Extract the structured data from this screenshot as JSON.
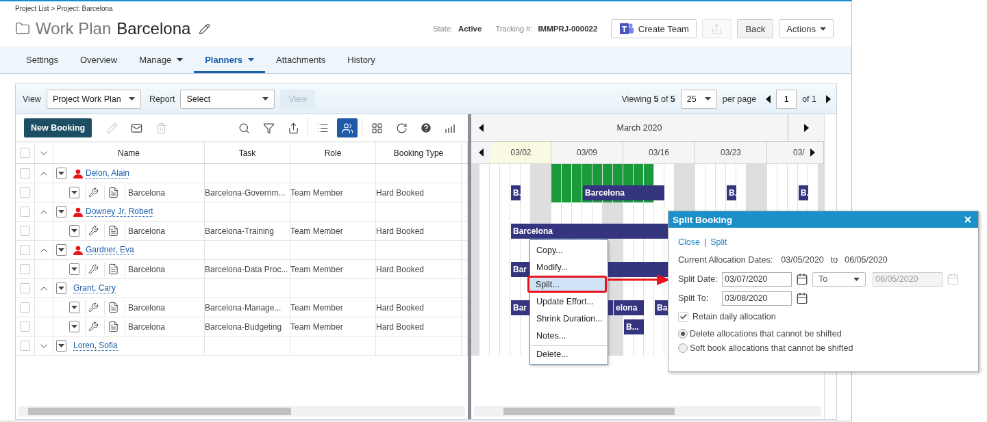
{
  "breadcrumb": "Project List > Project: Barcelona",
  "title": {
    "prefix": "Work Plan",
    "name": "Barcelona"
  },
  "meta": [
    {
      "label": "State:",
      "value": "Active"
    },
    {
      "label": "Tracking #:",
      "value": "IMMPRJ-000022"
    }
  ],
  "header_buttons": [
    {
      "kind": "team",
      "label": "Create Team",
      "disabled": false
    },
    {
      "kind": "export",
      "disabled": true
    },
    {
      "kind": "plain",
      "label": "Back",
      "disabled": false
    },
    {
      "kind": "dropdown",
      "label": "Actions",
      "disabled": false
    }
  ],
  "tabs": [
    {
      "label": "Settings",
      "selected": false,
      "dropdown": false
    },
    {
      "label": "Overview",
      "selected": false,
      "dropdown": false
    },
    {
      "label": "Manage",
      "selected": false,
      "dropdown": true
    },
    {
      "label": "Planners",
      "selected": true,
      "dropdown": true
    },
    {
      "label": "Attachments",
      "selected": false,
      "dropdown": false
    },
    {
      "label": "History",
      "selected": false,
      "dropdown": false
    }
  ],
  "filter_bar": {
    "view_label": "View",
    "view_value": "Project Work Plan",
    "report_label": "Report",
    "report_value": "Select",
    "view_button": {
      "label": "View",
      "disabled": true
    },
    "viewing": "Viewing **5** of **5**",
    "page_size": "25",
    "per_page": "per page",
    "page": "1",
    "of_pages": "of 1"
  },
  "toolbar": {
    "new_button": "New Booking",
    "groups": [
      [
        {
          "kind": "edit",
          "disabled": true,
          "selected": false
        },
        {
          "kind": "mail",
          "disabled": false,
          "selected": false
        },
        {
          "kind": "delete",
          "disabled": true,
          "selected": false
        }
      ],
      [
        {
          "kind": "search",
          "disabled": false,
          "selected": false
        },
        {
          "kind": "filter",
          "disabled": false,
          "selected": false
        },
        {
          "kind": "export",
          "disabled": false,
          "selected": false
        }
      ],
      [
        {
          "kind": "list",
          "disabled": false,
          "selected": false
        },
        {
          "kind": "people",
          "disabled": false,
          "selected": true
        }
      ],
      [
        {
          "kind": "grid",
          "disabled": false,
          "selected": false
        },
        {
          "kind": "refresh",
          "disabled": false,
          "selected": false
        },
        {
          "kind": "help",
          "disabled": false,
          "selected": false
        },
        {
          "kind": "chart",
          "disabled": false,
          "selected": false
        }
      ]
    ]
  },
  "grid": {
    "columns": [
      "Name",
      "Task",
      "Role",
      "Booking Type"
    ],
    "header_checked": false,
    "rows": [
      {
        "kind": "person",
        "name": "Delon, Alain",
        "alert": true,
        "expanded": true,
        "checked": false,
        "timeline": [
          {
            "kind": "gap"
          },
          {
            "kind": "gap"
          },
          {
            "kind": "gap"
          },
          {
            "kind": "gap"
          },
          {
            "kind": "gap"
          },
          {
            "kind": "gap"
          },
          {
            "kind": "gap"
          },
          {
            "kind": "alloc"
          },
          {
            "kind": "alloc"
          },
          {
            "kind": "alloc"
          },
          {
            "kind": "alloc"
          },
          {
            "kind": "alloc"
          },
          {
            "kind": "alloc"
          },
          {
            "kind": "alloc"
          },
          {
            "kind": "alloc"
          },
          {
            "kind": "alloc"
          },
          {
            "kind": "alloc"
          }
        ]
      },
      {
        "kind": "booking",
        "project": "Barcelona",
        "task": "Barcelona-Governm...",
        "role": "Team Member",
        "booking_type": "Hard Booked",
        "checked": false,
        "timeline": [
          {
            "kind": "gap"
          },
          {
            "kind": "gap"
          },
          {
            "kind": "gap"
          },
          {
            "kind": "bar",
            "label": "B."
          },
          {
            "kind": "gap"
          },
          {
            "kind": "gap"
          },
          {
            "kind": "gap"
          },
          {
            "kind": "alloc"
          },
          {
            "kind": "alloc"
          },
          {
            "kind": "alloc"
          },
          {
            "kind": "alloc-bar",
            "label": "Barcelona"
          },
          {
            "kind": "alloc-bar"
          },
          {
            "kind": "alloc-bar"
          },
          {
            "kind": "alloc-bar"
          },
          {
            "kind": "alloc-bar"
          },
          {
            "kind": "alloc-bar"
          },
          {
            "kind": "alloc-bar"
          },
          {
            "kind": "bar"
          },
          {
            "kind": "gap"
          },
          {
            "kind": "gap"
          },
          {
            "kind": "gap"
          },
          {
            "kind": "gap"
          },
          {
            "kind": "gap"
          },
          {
            "kind": "gap"
          },
          {
            "kind": "bar",
            "label": "B."
          },
          {
            "kind": "gap"
          },
          {
            "kind": "gap"
          },
          {
            "kind": "gap"
          },
          {
            "kind": "gap"
          },
          {
            "kind": "gap"
          },
          {
            "kind": "gap"
          },
          {
            "kind": "bar",
            "label": "B."
          }
        ]
      },
      {
        "kind": "person",
        "name": "Downey Jr, Robert",
        "alert": true,
        "expanded": true,
        "checked": false
      },
      {
        "kind": "booking",
        "project": "Barcelona",
        "task": "Barcelona-Training",
        "role": "Team Member",
        "booking_type": "Hard Booked",
        "checked": false,
        "timeline": [
          {
            "kind": "gap"
          },
          {
            "kind": "gap"
          },
          {
            "kind": "gap"
          },
          {
            "kind": "bar",
            "label": "Barcelona"
          },
          {
            "kind": "bar"
          },
          {
            "kind": "bar"
          },
          {
            "kind": "bar"
          },
          {
            "kind": "bar"
          },
          {
            "kind": "bar"
          },
          {
            "kind": "bar"
          },
          {
            "kind": "bar"
          },
          {
            "kind": "bar"
          },
          {
            "kind": "bar"
          },
          {
            "kind": "bar"
          },
          {
            "kind": "bar"
          },
          {
            "kind": "bar"
          },
          {
            "kind": "bar"
          },
          {
            "kind": "bar"
          },
          {
            "kind": "bar"
          },
          {
            "kind": "bar"
          },
          {
            "kind": "bar"
          }
        ]
      },
      {
        "kind": "person",
        "name": "Gardner, Eva",
        "alert": true,
        "expanded": true,
        "checked": false
      },
      {
        "kind": "booking",
        "project": "Barcelona",
        "task": "Barcelona-Data Proc...",
        "role": "Team Member",
        "booking_type": "Hard Booked",
        "checked": false,
        "timeline": [
          {
            "kind": "gap"
          },
          {
            "kind": "gap"
          },
          {
            "kind": "gap"
          },
          {
            "kind": "bar",
            "label": "Bar"
          },
          {
            "kind": "bar"
          },
          {
            "kind": "bar"
          },
          {
            "kind": "bar"
          },
          {
            "kind": "bar"
          },
          {
            "kind": "bar"
          },
          {
            "kind": "bar"
          },
          {
            "kind": "bar"
          },
          {
            "kind": "bar"
          },
          {
            "kind": "bar"
          },
          {
            "kind": "bar"
          },
          {
            "kind": "bar"
          },
          {
            "kind": "bar"
          },
          {
            "kind": "bar"
          },
          {
            "kind": "bar"
          },
          {
            "kind": "bar"
          },
          {
            "kind": "bar"
          },
          {
            "kind": "bar"
          }
        ]
      },
      {
        "kind": "person",
        "name": "Grant, Cary",
        "alert": false,
        "expanded": true,
        "checked": false
      },
      {
        "kind": "booking",
        "project": "Barcelona",
        "task": "Barcelona-Manage...",
        "role": "Team Member",
        "booking_type": "Hard Booked",
        "checked": false,
        "timeline": [
          {
            "kind": "gap"
          },
          {
            "kind": "gap"
          },
          {
            "kind": "gap"
          },
          {
            "kind": "bar",
            "label": "Bar"
          },
          {
            "kind": "bar"
          },
          {
            "kind": "bar"
          },
          {
            "kind": "bar"
          },
          {
            "kind": "bar"
          },
          {
            "kind": "bar"
          },
          {
            "kind": "bar"
          },
          {
            "kind": "bar"
          },
          {
            "kind": "bar"
          },
          {
            "kind": "bar"
          },
          {
            "kind": "bar",
            "label": "elona"
          },
          {
            "kind": "bar"
          },
          {
            "kind": "bar"
          },
          {
            "kind": "gap"
          },
          {
            "kind": "bar",
            "label": "Ba"
          },
          {
            "kind": "bar"
          },
          {
            "kind": "bar"
          },
          {
            "kind": "bar"
          }
        ]
      },
      {
        "kind": "booking",
        "project": "Barcelona",
        "task": "Barcelona-Budgeting",
        "role": "Team Member",
        "booking_type": "Hard Booked",
        "checked": false,
        "timeline": [
          {
            "kind": "gap"
          },
          {
            "kind": "gap"
          },
          {
            "kind": "gap"
          },
          {
            "kind": "gap"
          },
          {
            "kind": "gap"
          },
          {
            "kind": "gap"
          },
          {
            "kind": "gap"
          },
          {
            "kind": "gap"
          },
          {
            "kind": "gap"
          },
          {
            "kind": "gap"
          },
          {
            "kind": "gap"
          },
          {
            "kind": "gap"
          },
          {
            "kind": "gap"
          },
          {
            "kind": "gap"
          },
          {
            "kind": "bar",
            "label": "B..."
          },
          {
            "kind": "bar"
          }
        ]
      },
      {
        "kind": "person",
        "name": "Loren, Sofia",
        "alert": false,
        "expanded": false,
        "checked": false
      }
    ]
  },
  "gantt": {
    "month": "March 2020",
    "weeks": [
      {
        "label": "03/02",
        "today": true
      },
      {
        "label": "03/09",
        "today": false
      },
      {
        "label": "03/16",
        "today": false
      },
      {
        "label": "03/23",
        "today": false
      },
      {
        "label": "03/",
        "today": false
      }
    ]
  },
  "context_menu": [
    {
      "label": "Copy...",
      "selected": false,
      "separator_before": false
    },
    {
      "label": "Modify...",
      "selected": false,
      "separator_before": false
    },
    {
      "label": "Split...",
      "selected": true,
      "separator_before": false
    },
    {
      "label": "Update Effort...",
      "selected": false,
      "separator_before": false
    },
    {
      "label": "Shrink Duration...",
      "selected": false,
      "separator_before": false
    },
    {
      "label": "Notes...",
      "selected": false,
      "separator_before": false
    },
    {
      "label": "Delete...",
      "selected": false,
      "separator_before": true
    }
  ],
  "dialog": {
    "title": "Split Booking",
    "links": [
      "Close",
      "Split"
    ],
    "link_separator": "|",
    "current_label": "Current Allocation Dates:",
    "current_from": "03/05/2020",
    "current_to_label": "to",
    "current_to": "06/05/2020",
    "split_date_label": "Split Date:",
    "split_date": "03/07/2020",
    "range_mode": "To",
    "range_end": "06/05/2020",
    "range_end_disabled": true,
    "split_to_label": "Split To:",
    "split_to": "03/08/2020",
    "retain": {
      "label": "Retain daily allocation",
      "checked": true
    },
    "options": [
      {
        "label": "Delete allocations that cannot be shifted",
        "selected": true
      },
      {
        "label": "Soft book allocations that cannot be shifted",
        "selected": false
      }
    ]
  }
}
